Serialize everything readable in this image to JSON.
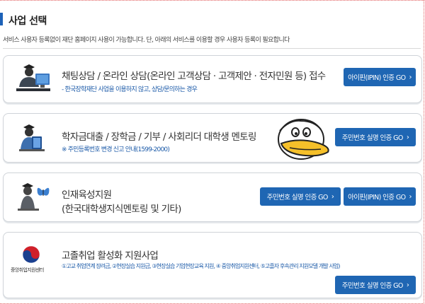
{
  "page": {
    "title": "사업 선택",
    "notice": "서비스 사용자 등록없이 재단 홈페이지 사용이 가능합니다. 단, 아래의 서비스를 이용할 경우 사용자 등록이 필요합니다"
  },
  "cards": [
    {
      "title": "채팅상담 / 온라인 상담(온라인 고객상담 · 고객제안 · 전자민원 등) 접수",
      "subtitle": "- 한국장학재단 사업을 이용하지 않고, 상담/문의하는 경우",
      "icon": "counselor-computer-icon",
      "buttons": [
        {
          "label": "아이핀(IPIN) 인증 GO"
        }
      ]
    },
    {
      "title": "학자금대출 / 장학금 / 기부 / 사회리더 대학생 멘토링",
      "subtitle": "※ 주민등록번호 변경 신고 안내(1599-2000)",
      "icon": "graduate-book-icon",
      "buttons": [
        {
          "label": "주민번호 실명 인증 GO"
        }
      ]
    },
    {
      "title_line1": "인재육성지원",
      "title_line2": "(한국대학생지식멘토링 및 기타)",
      "icon": "graduate-butterfly-icon",
      "buttons": [
        {
          "label": "주민번호 실명 인증 GO"
        },
        {
          "label": "아이핀(IPIN) 인증 GO"
        }
      ]
    },
    {
      "title": "고졸취업 활성화 지원사업",
      "subtitle": "①고교 취업연계 장려금, ②현장실습 지원금, ③현장실습 기업현장교육 지원, ④ 중앙취업지원센터, ⑤고졸자 후속관리 지원모델 개발 사업)",
      "logo_caption": "중앙취업지원센터",
      "icon": "taegeuk-logo-icon",
      "buttons": [
        {
          "label": "주민번호 실명 인증 GO"
        }
      ]
    }
  ],
  "colors": {
    "accent": "#1f66b3",
    "link": "#1b5aa8",
    "title_bar": "#1d62b8"
  }
}
